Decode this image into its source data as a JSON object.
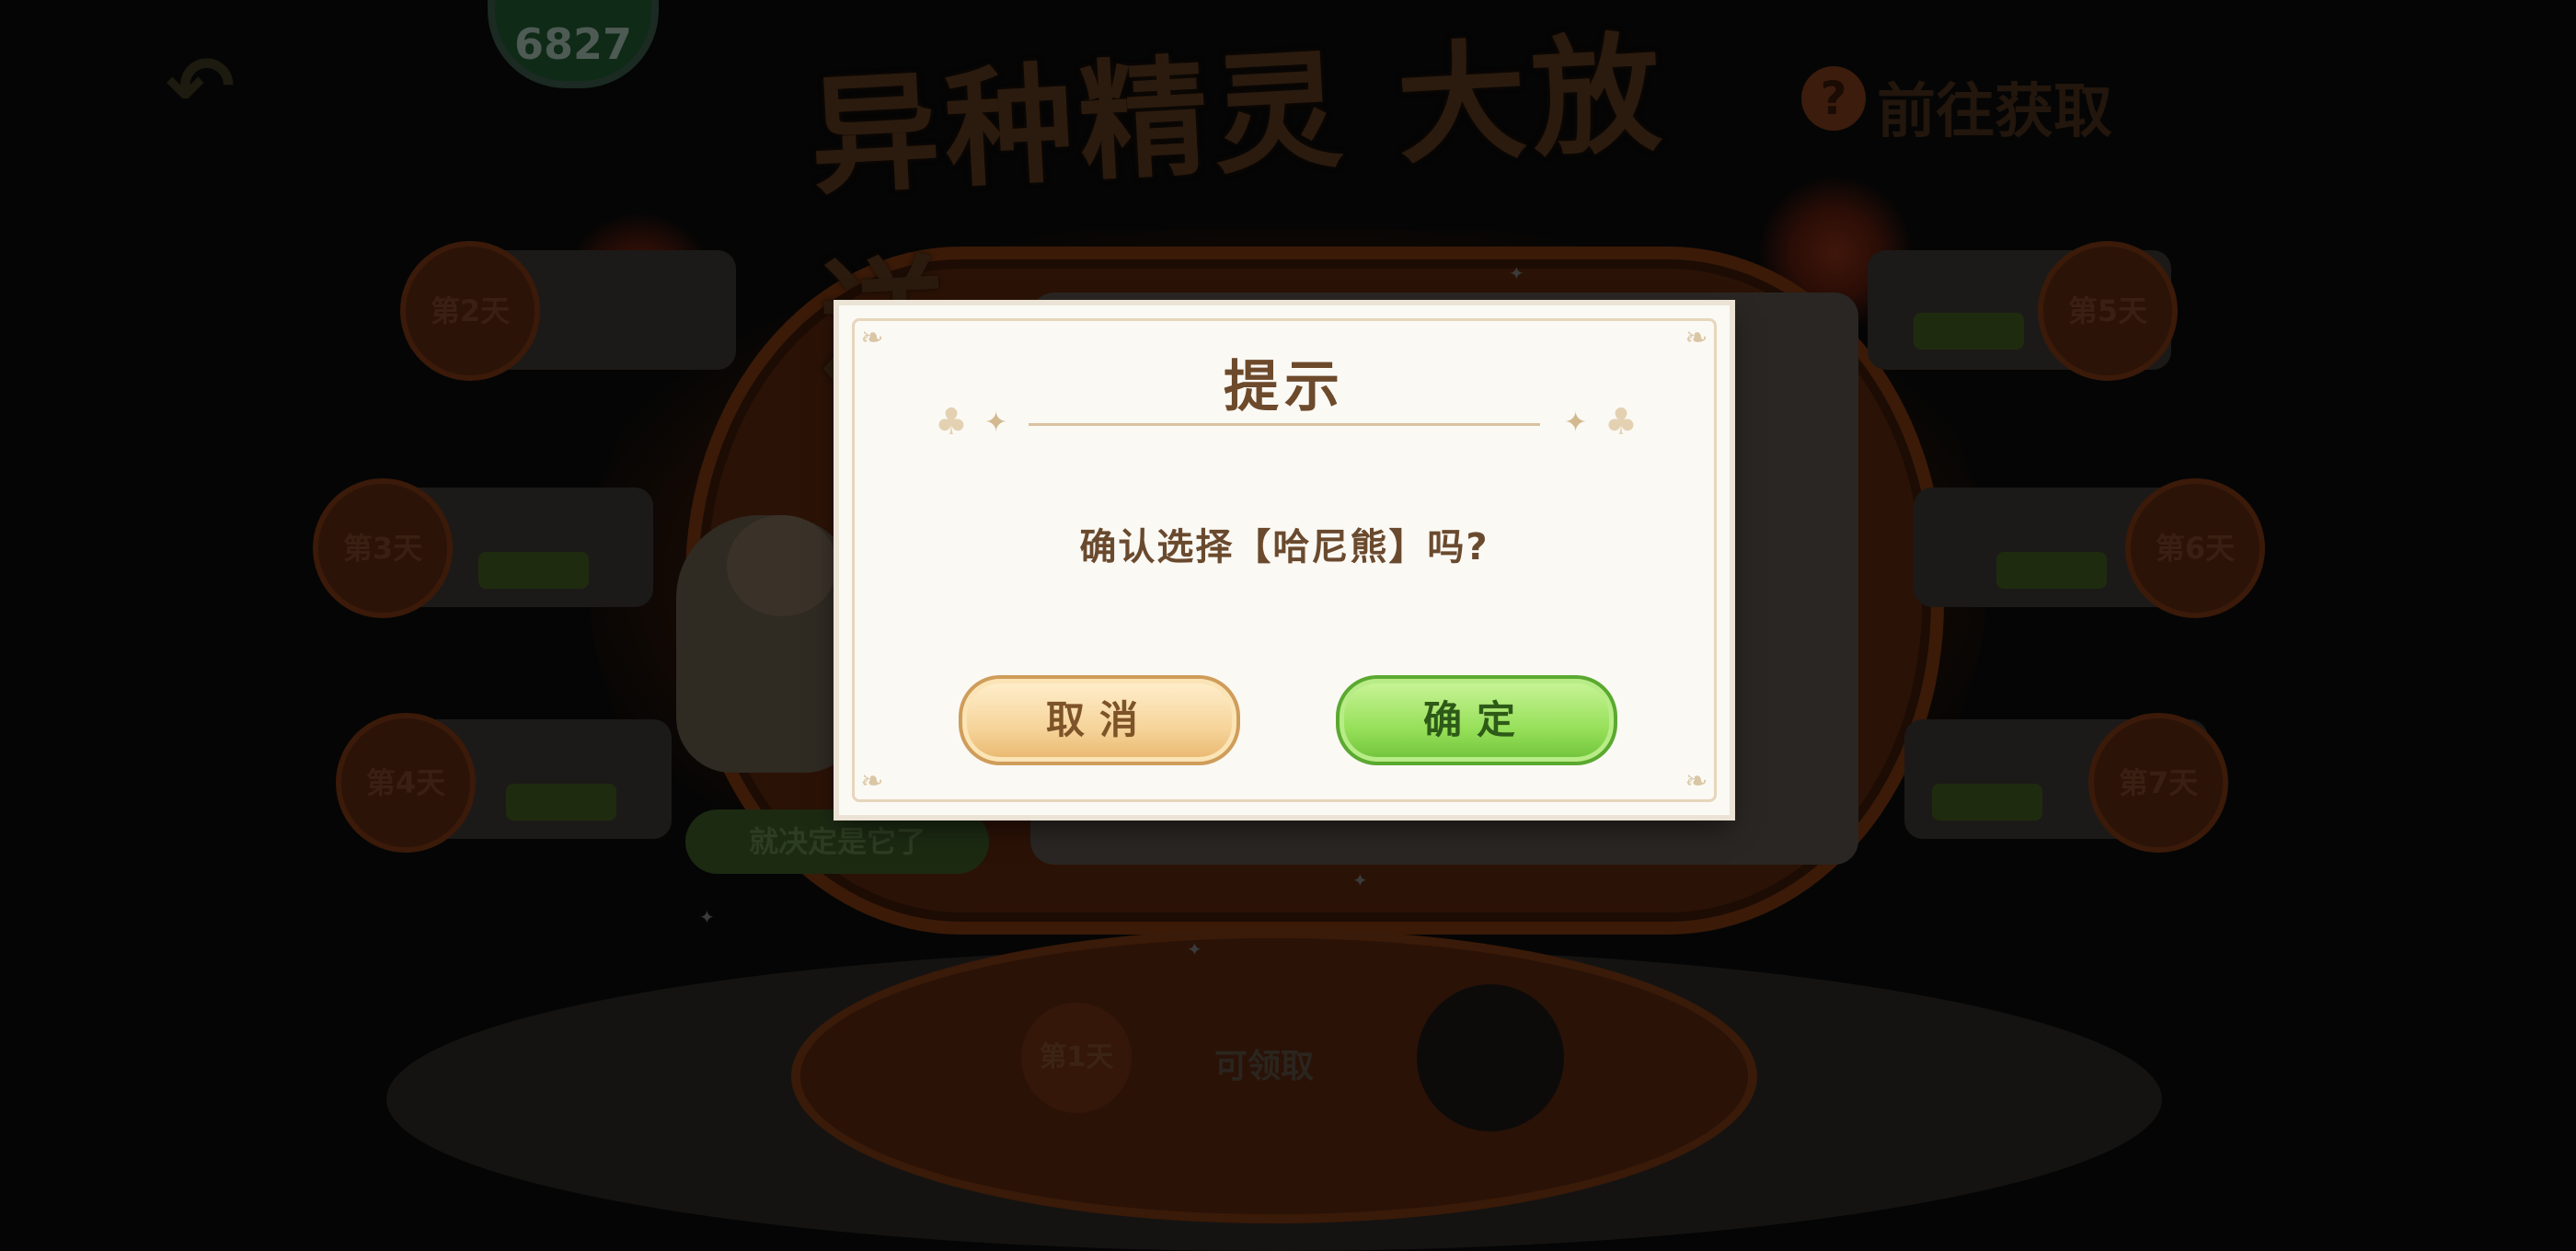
{
  "background": {
    "title": "异种精灵 大放送",
    "help_symbol": "?",
    "side_link": "前往获取",
    "top_badge": "6827",
    "days": [
      {
        "label": "第2天"
      },
      {
        "label": "第3天"
      },
      {
        "label": "第4天"
      },
      {
        "label": "第5天"
      },
      {
        "label": "第6天"
      },
      {
        "label": "第7天"
      },
      {
        "label": "第1天"
      }
    ],
    "green_banner": "就决定是它了",
    "bottom_text": "可领取"
  },
  "dialog": {
    "title": "提示",
    "message": "确认选择【哈尼熊】吗?",
    "cancel_label": "取消",
    "confirm_label": "确定"
  },
  "colors": {
    "dialog_bg": "#fbf9f4",
    "title_text": "#6c4a2b",
    "cancel_button": "#f6d49a",
    "confirm_button": "#97e05a"
  }
}
